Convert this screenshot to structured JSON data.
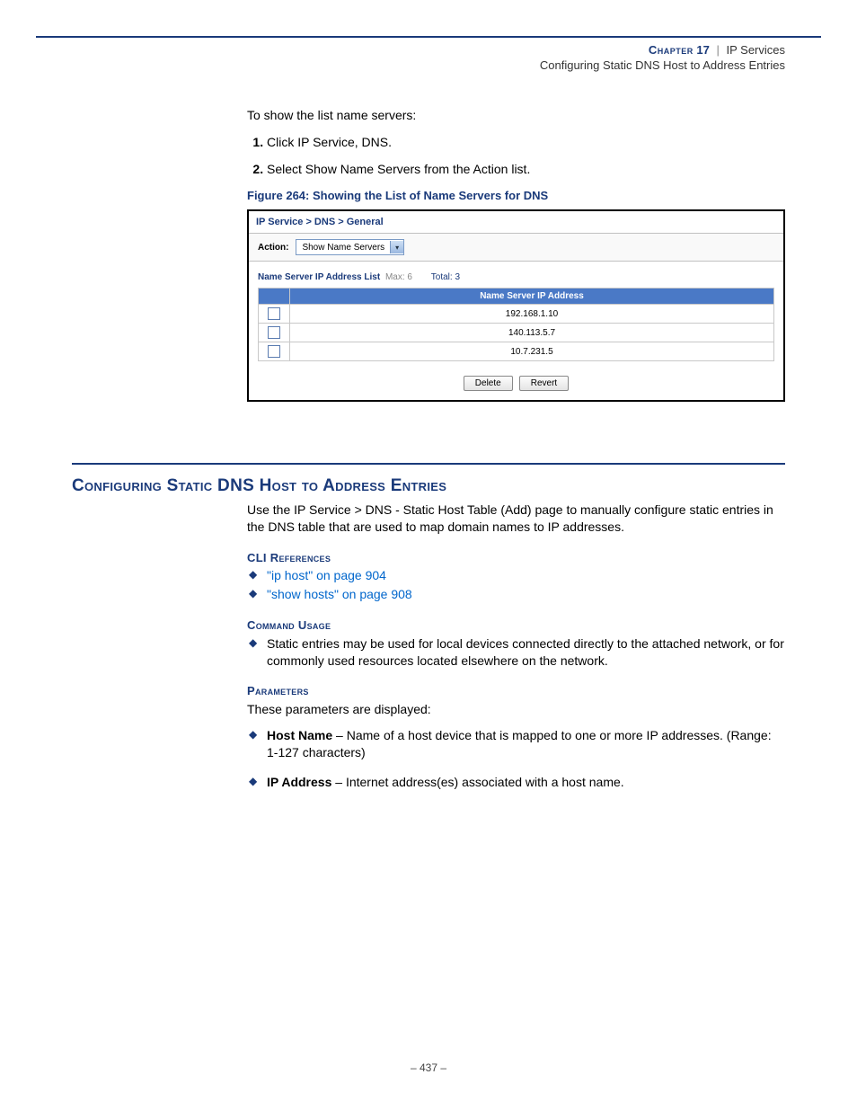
{
  "header": {
    "chapter_word": "Chapter",
    "chapter_num": "17",
    "pipe": "|",
    "section": "IP Services",
    "subtitle": "Configuring Static DNS Host to Address Entries"
  },
  "intro": "To show the list name servers:",
  "steps": [
    "Click IP Service, DNS.",
    "Select Show Name Servers from the Action list."
  ],
  "figure": {
    "caption": "Figure 264:  Showing the List of Name Servers for DNS",
    "breadcrumb": "IP Service > DNS > General",
    "action_label": "Action:",
    "action_value": "Show Name Servers",
    "list_title": "Name Server IP Address List",
    "max_label": "Max: 6",
    "total_label": "Total: 3",
    "col_header": "Name Server IP Address",
    "rows": [
      "192.168.1.10",
      "140.113.5.7",
      "10.7.231.5"
    ],
    "buttons": {
      "delete": "Delete",
      "revert": "Revert"
    }
  },
  "section2": {
    "title": "Configuring Static DNS Host to Address Entries",
    "intro": "Use the IP Service > DNS - Static Host Table (Add) page to manually configure static entries in the DNS table that are used to map domain names to IP addresses.",
    "cli_head": "CLI References",
    "cli_refs": [
      "\"ip host\" on page 904",
      "\"show hosts\" on page 908"
    ],
    "usage_head": "Command Usage",
    "usage_items": [
      "Static entries may be used for local devices connected directly to the attached network, or for commonly used resources located elsewhere on the network."
    ],
    "params_head": "Parameters",
    "params_intro": "These parameters are displayed:",
    "params": [
      {
        "name": "Host Name",
        "desc": " – Name of a host device that is mapped to one or more IP addresses. (Range: 1-127 characters)"
      },
      {
        "name": "IP Address",
        "desc": " – Internet address(es) associated with a host name."
      }
    ]
  },
  "page_number": "–  437  –"
}
